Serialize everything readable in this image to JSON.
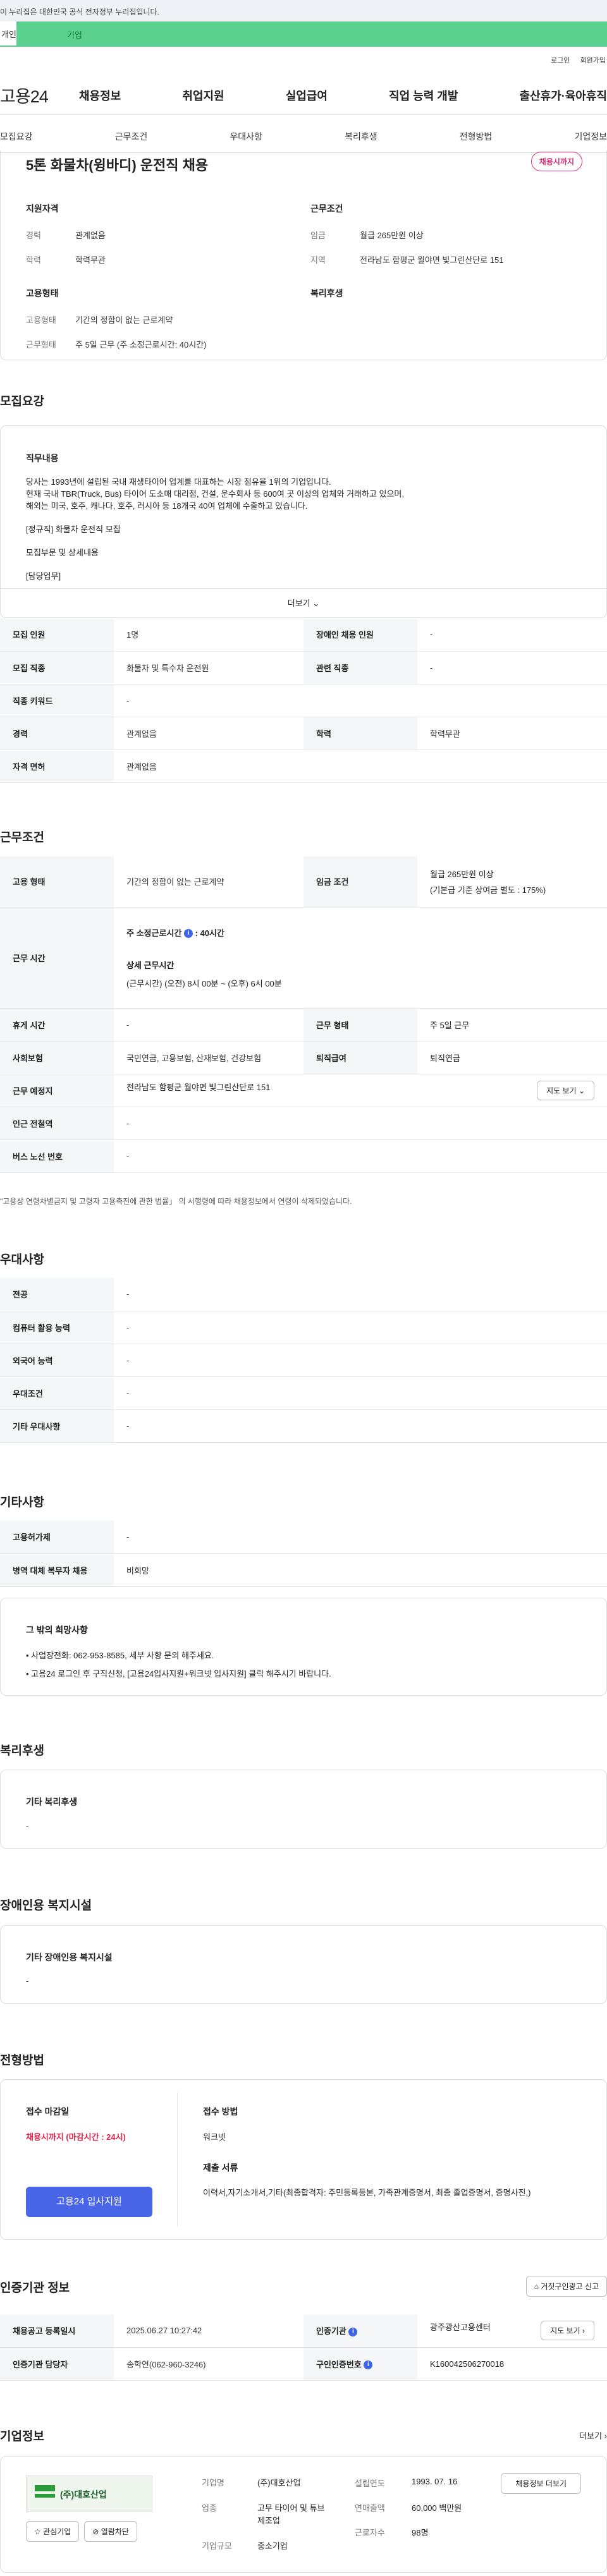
{
  "gov_bar": "이 누리집은 대한민국 공식 전자정부 누리집입니다.",
  "tabs": {
    "personal": "개인",
    "company": "기업"
  },
  "util": {
    "login": "로그인",
    "signup": "회원가입"
  },
  "logo": {
    "text": "고용",
    "number": "24"
  },
  "gnb": [
    "채용정보",
    "취업지원",
    "실업급여",
    "직업 능력 개발",
    "출산휴가·육아휴직"
  ],
  "subnav": [
    "모집요강",
    "근무조건",
    "우대사항",
    "복리후생",
    "전형방법",
    "기업정보"
  ],
  "summary": {
    "title": "5톤 화물차(윙바디) 운전직 채용",
    "badge": "채용시까지",
    "qual_title": "지원자격",
    "career_k": "경력",
    "career_v": "관계없음",
    "edu_k": "학력",
    "edu_v": "학력무관",
    "cond_title": "근무조건",
    "wage_k": "임금",
    "wage_v": "월급 265만원 이상",
    "region_k": "지역",
    "region_v": "전라남도 함평군 월야면 빛그린산단로 151",
    "emp_title": "고용형태",
    "emptype_k": "고용형태",
    "emptype_v": "기간의 정함이 없는 근로계약",
    "worktype_k": "근무형태",
    "worktype_v": "주 5일 근무 (주 소정근로시간: 40시간)",
    "welfare_title": "복리후생"
  },
  "recruit": {
    "title": "모집요강",
    "job_title": "직무내용",
    "p1": "당사는 1993년에 설립된 국내 재생타이어 업계를 대표하는 시장 점유율 1위의 기업입니다.",
    "p2": "현재 국내 TBR(Truck, Bus) 타이어 도소매 대리점, 건설, 운수회사 등 600여 곳 이상의 업체와 거래하고 있으며,",
    "p3": "해외는 미국, 호주, 캐나다, 호주, 러시아 등 18개국 40여 업체에 수출하고 있습니다.",
    "p4": "[정규직] 화물차 운전직 모집",
    "p5": "모집부문 및 상세내용",
    "p6": "[담당업무]",
    "more": "더보기"
  },
  "recruit_table": {
    "count_h": "모집 인원",
    "count_v": "1명",
    "disabled_h": "장애인 채용 인원",
    "disabled_v": "-",
    "job_h": "모집 직종",
    "job_v": "화물차 및 특수차 운전원",
    "related_h": "관련 직종",
    "related_v": "-",
    "keyword_h": "직종 키워드",
    "keyword_v": "-",
    "career_h": "경력",
    "career_v": "관계없음",
    "edu_h": "학력",
    "edu_v": "학력무관",
    "license_h": "자격 면허",
    "license_v": "관계없음"
  },
  "work": {
    "title": "근무조건",
    "emptype_h": "고용 형태",
    "emptype_v": "기간의 정함이 없는 근로계약",
    "wage_h": "임금 조건",
    "wage_v1": "월급 265만원 이상",
    "wage_v2": "(기본급 기준 상여금 별도 : 175%)",
    "time_h": "근무 시간",
    "time_v1_label": "주 소정근로시간",
    "time_v1_val": ": 40시간",
    "time_v2": "상세 근무시간",
    "time_v3": "(근무시간) (오전) 8시 00분 ~ (오후) 6시 00분",
    "rest_h": "휴게 시간",
    "rest_v": "-",
    "form_h": "근무 형태",
    "form_v": "주 5일 근무",
    "ins_h": "사회보험",
    "ins_v": "국민연금, 고용보험, 산재보험, 건강보험",
    "sev_h": "퇴직급여",
    "sev_v": "퇴직연금",
    "place_h": "근무 예정지",
    "place_v": "전라남도 함평군 월야면 빛그린산단로 151",
    "map_btn": "지도 보기",
    "station_h": "인근 전철역",
    "station_v": "-",
    "bus_h": "버스 노선 번호",
    "bus_v": "-",
    "note": "\"고용상 연령차별금지 및 고령자 고용촉진에 관한 법률」 의 시행령에 따라 채용정보에서 연령이 삭제되었습니다."
  },
  "pref": {
    "title": "우대사항",
    "major_h": "전공",
    "major_v": "-",
    "pc_h": "컴퓨터 활용 능력",
    "pc_v": "-",
    "lang_h": "외국어 능력",
    "lang_v": "-",
    "cond_h": "우대조건",
    "cond_v": "-",
    "etc_h": "기타 우대사항",
    "etc_v": "-"
  },
  "etc": {
    "title": "기타사항",
    "permit_h": "고용허가제",
    "permit_v": "-",
    "military_h": "병역 대체 복무자 채용",
    "military_v": "비희망",
    "wish_title": "그 밖의 희망사항",
    "wish1": "• 사업장전화: 062-953-8585, 세부 사항 문의 해주세요.",
    "wish2": "• 고용24 로그인 후 구직신청, [고용24입사지원+워크넷 입사지원] 클릭 해주시기 바랍니다."
  },
  "welfare": {
    "title": "복리후생",
    "sub": "기타 복리후생",
    "val": "-"
  },
  "facility": {
    "title": "장애인용 복지시설",
    "sub": "기타 장애인용 복지시설",
    "val": "-"
  },
  "apply": {
    "title": "전형방법",
    "deadline_h": "접수 마감일",
    "deadline_v": "채용시까지 (마감시간 : 24시)",
    "apply_btn": "고용24 입사지원",
    "method_h": "접수 방법",
    "method_v": "워크넷",
    "docs_h": "제출 서류",
    "docs_v": "이력서,자기소개서,기타(최종합격자: 주민등록등본, 가족관계증명서, 최종 졸업증명서, 증명사진,)"
  },
  "agency": {
    "title": "인증기관 정보",
    "report_btn": "거짓구인광고 신고",
    "date_h": "채용공고 등록일시",
    "date_v": "2025.06.27 10:27:42",
    "org_h": "인증기관",
    "org_v": "광주광산고용센터",
    "map_btn": "지도 보기",
    "manager_h": "인증기관 담당자",
    "manager_v": "송학연(062-960-3246)",
    "reg_h": "구인인증번호",
    "reg_v": "K160042506270018"
  },
  "company": {
    "title": "기업정보",
    "more": "더보기",
    "logo_text": "(주)대호산업",
    "fav_btn": "관심기업",
    "block_btn": "열람차단",
    "name_k": "기업명",
    "name_v": "(주)대호산업",
    "ind_k": "업종",
    "ind_v": "고무 타이어 및 튜브 제조업",
    "size_k": "기업규모",
    "size_v": "중소기업",
    "year_k": "설립연도",
    "year_v": "1993. 07. 16",
    "sales_k": "연매출액",
    "sales_v": "60,000 백만원",
    "emp_k": "근로자수",
    "emp_v": "98명",
    "jobs_btn": "채용정보 더보기"
  },
  "colors": {
    "green": "#5bd08f",
    "blue": "#4a66e8",
    "pink": "#e0307a"
  }
}
